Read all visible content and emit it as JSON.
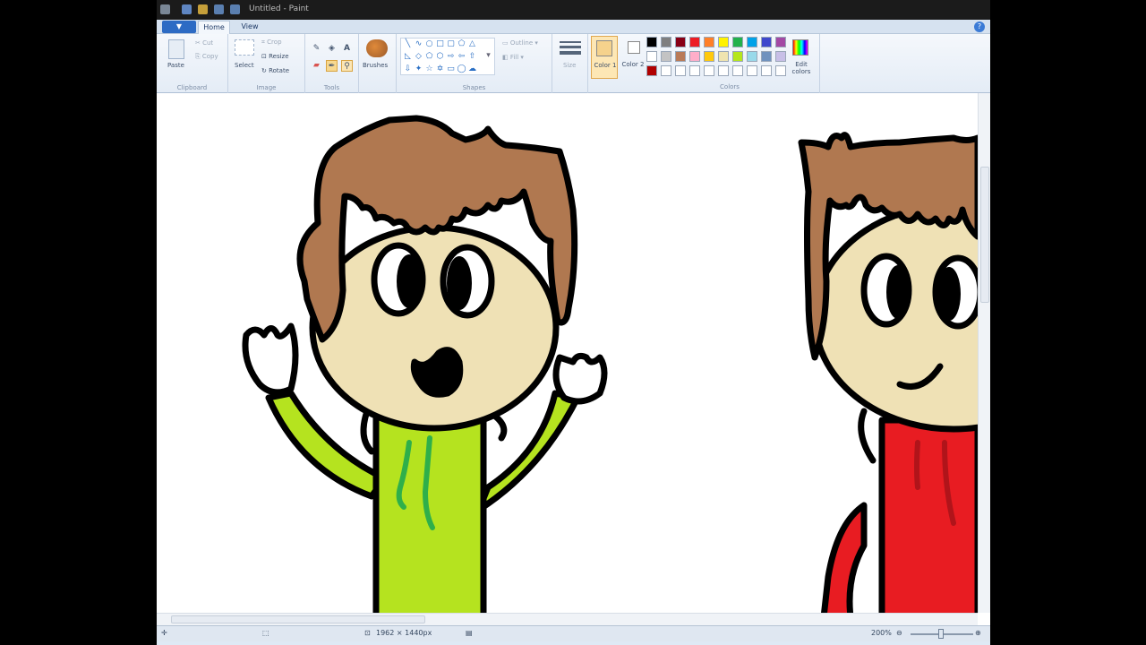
{
  "window": {
    "title": "Untitled - Paint"
  },
  "menu": {
    "file_label": "▼",
    "tabs": [
      {
        "label": "Home"
      },
      {
        "label": "View"
      }
    ],
    "help": "?"
  },
  "ribbon": {
    "clipboard": {
      "group": "Clipboard",
      "paste": "Paste",
      "cut": "Cut",
      "copy": "Copy"
    },
    "image": {
      "group": "Image",
      "select": "Select",
      "crop": "Crop",
      "resize": "Resize",
      "rotate": "Rotate"
    },
    "tools": {
      "group": "Tools"
    },
    "brushes": {
      "label": "Brushes"
    },
    "shapes": {
      "group": "Shapes",
      "outline": "Outline",
      "fill": "Fill"
    },
    "size": {
      "label": "Size"
    },
    "colors": {
      "group": "Colors",
      "color1": "Color 1",
      "color2": "Color 2",
      "edit": "Edit colors",
      "palette_row1": [
        "#000000",
        "#7f7f7f",
        "#880015",
        "#ed1c24",
        "#ff7f27",
        "#fff200",
        "#22b14c",
        "#00a2e8",
        "#3f48cc",
        "#a349a4"
      ],
      "palette_row2": [
        "#ffffff",
        "#c3c3c3",
        "#b97a57",
        "#ffaec9",
        "#ffc90e",
        "#efe4b0",
        "#b5e61d",
        "#99d9ea",
        "#7092be",
        "#c8bfe7"
      ],
      "palette_row3": [
        "#b00000"
      ]
    }
  },
  "status": {
    "dimensions": "1962 × 1440px",
    "zoom": "200%"
  },
  "colors": {
    "hair": "#b07850",
    "skin": "#efe1b5",
    "hoodie_green": "#b5e31f",
    "hoodie_stripe": "#2faf4a",
    "hoodie_red": "#e81c22"
  }
}
